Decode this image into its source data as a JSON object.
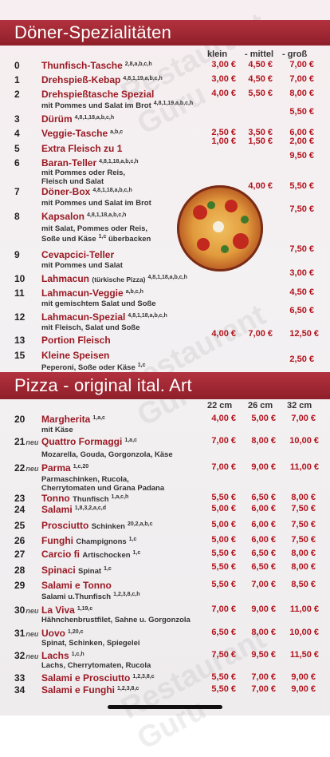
{
  "watermark": "Restaurant Guru",
  "sections": [
    {
      "id": "doener",
      "title": "Döner-Spezialitäten",
      "columns": [
        "klein",
        "- mittel",
        "- groß"
      ]
    },
    {
      "id": "pizza",
      "title": "Pizza - original ital. Art",
      "columns": [
        "22 cm",
        "26 cm",
        "32 cm"
      ]
    }
  ],
  "doener_items": [
    {
      "num": "0",
      "name": "Thunfisch-Tasche",
      "sup": "2,8,a,b,c,h",
      "p1": "3,00 €",
      "p2": "4,50 €",
      "p3": "7,00 €"
    },
    {
      "num": "1",
      "name": "Drehspieß-Kebap",
      "sup": "4,8,1,19,a,b,c,h",
      "p1": "3,00 €",
      "p2": "4,50 €",
      "p3": "7,00 €"
    },
    {
      "num": "2",
      "name": "Drehspießtasche Spezial",
      "sup": "",
      "p1": "4,00 €",
      "p2": "5,50 €",
      "p3": "8,00 €"
    },
    {
      "num": "3",
      "name": "Dürüm",
      "sup": "4,8,1,18,a,b,c,h",
      "p1": "",
      "p2": "",
      "p3": "5,50 €"
    },
    {
      "num": "4",
      "name": "Veggie-Tasche",
      "sup": "a,b,c",
      "p1": "2,50 €",
      "p2": "3,50 €",
      "p3": "6,00 €"
    },
    {
      "num": "5",
      "name": "Extra Fleisch zu 1",
      "sup": "",
      "p1": "1,00 €",
      "p2": "1,50 €",
      "p3": "2,00 €"
    },
    {
      "num": "6",
      "name": "Baran-Teller",
      "sup": "4,8,1,18,a,b,c,h",
      "p1": "",
      "p2": "",
      "p3": "9,50 €"
    },
    {
      "num": "7",
      "name": "Döner-Box",
      "sup": "4,8,1,18,a,b,c,h",
      "p1": "",
      "p2": "4,00 €",
      "p3": "5,50 €"
    },
    {
      "num": "8",
      "name": "Kapsalon",
      "sup": "4,8,1,18,a,b,c,h",
      "p1": "",
      "p2": "",
      "p3": "7,50 €"
    },
    {
      "num": "9",
      "name": "Cevapcici-Teller",
      "sup": "",
      "p1": "",
      "p2": "",
      "p3": "7,50 €"
    },
    {
      "num": "10",
      "name": "Lahmacun",
      "sup": "4,8,1,18,a,b,c,h",
      "p1": "",
      "p2": "",
      "p3": "3,00 €"
    },
    {
      "num": "11",
      "name": "Lahmacun-Veggie",
      "sup": "a,b,c,h",
      "p1": "",
      "p2": "",
      "p3": "4,50 €"
    },
    {
      "num": "12",
      "name": "Lahmacun-Spezial",
      "sup": "4,8,1,18,a,b,c,h",
      "p1": "",
      "p2": "",
      "p3": "6,50 €"
    },
    {
      "num": "13",
      "name": "Portion Fleisch",
      "sup": "",
      "p1": "4,00 €",
      "p2": "7,00 €",
      "p3": "12,50 €"
    },
    {
      "num": "15",
      "name": "Kleine Speisen",
      "sup": "",
      "p1": "",
      "p2": "",
      "p3": "2,50 €"
    }
  ],
  "doener_desc": {
    "d2": "mit Pommes und Salat im Brot",
    "d2sup": "4,8,1,19,a,b,c,h",
    "d6a": "mit Pommes oder Reis,",
    "d6b": "Fleisch und Salat",
    "d7": "mit Pommes und Salat im Brot",
    "d8a": "mit Salat, Pommes oder Reis,",
    "d8b": "Soße und Käse",
    "d8sup": "1,c",
    "d8c": "überbacken",
    "d9": "mit Pommes und Salat",
    "d10": "(türkische Pizza)",
    "d11": "mit gemischtem Salat und Soße",
    "d12": "mit Fleisch, Salat und Soße",
    "d15": "Peperoni, Soße oder Käse",
    "d15sup": "1,c"
  },
  "pizza_items": [
    {
      "num": "20",
      "neu": "",
      "name": "Margherita",
      "sup": "1,a,c",
      "p1": "4,00 €",
      "p2": "5,00 €",
      "p3": "7,00 €"
    },
    {
      "num": "21",
      "neu": "neu",
      "name": "Quattro Formaggi",
      "sup": "1,a,c",
      "p1": "7,00 €",
      "p2": "8,00 €",
      "p3": "10,00 €"
    },
    {
      "num": "22",
      "neu": "neu",
      "name": "Parma",
      "sup": "1,c,20",
      "p1": "7,00 €",
      "p2": "9,00 €",
      "p3": "11,00 €"
    },
    {
      "num": "23",
      "neu": "",
      "name": "Tonno",
      "sup": "",
      "p1": "5,50 €",
      "p2": "6,50 €",
      "p3": "8,00 €"
    },
    {
      "num": "24",
      "neu": "",
      "name": "Salami",
      "sup": "1,8,3,2,a,c,d",
      "p1": "5,00 €",
      "p2": "6,00 €",
      "p3": "7,50 €"
    },
    {
      "num": "25",
      "neu": "",
      "name": "Prosciutto",
      "sup": "",
      "p1": "5,00 €",
      "p2": "6,00 €",
      "p3": "7,50 €"
    },
    {
      "num": "26",
      "neu": "",
      "name": "Funghi",
      "sup": "",
      "p1": "5,00 €",
      "p2": "6,00 €",
      "p3": "7,50 €"
    },
    {
      "num": "27",
      "neu": "",
      "name": "Carcio fi",
      "sup": "",
      "p1": "5,50 €",
      "p2": "6,50 €",
      "p3": "8,00 €"
    },
    {
      "num": "28",
      "neu": "",
      "name": "Spinaci",
      "sup": "",
      "p1": "5,50 €",
      "p2": "6,50 €",
      "p3": "8,00 €"
    },
    {
      "num": "29",
      "neu": "",
      "name": "Salami e Tonno",
      "sup": "",
      "p1": "5,50 €",
      "p2": "7,00 €",
      "p3": "8,50 €"
    },
    {
      "num": "30",
      "neu": "neu",
      "name": "La Viva",
      "sup": "1,19,c",
      "p1": "7,00 €",
      "p2": "9,00 €",
      "p3": "11,00 €"
    },
    {
      "num": "31",
      "neu": "neu",
      "name": "Uovo",
      "sup": "1,20,c",
      "p1": "6,50 €",
      "p2": "8,00 €",
      "p3": "10,00 €"
    },
    {
      "num": "32",
      "neu": "neu",
      "name": "Lachs",
      "sup": "1,c,h",
      "p1": "7,50 €",
      "p2": "9,50 €",
      "p3": "11,50 €"
    },
    {
      "num": "33",
      "neu": "",
      "name": "Salami e Prosciutto",
      "sup": "1,2,3,8,c",
      "p1": "5,50 €",
      "p2": "7,00 €",
      "p3": "9,00 €"
    },
    {
      "num": "34",
      "neu": "",
      "name": "Salami e Funghi",
      "sup": "1,2,3,8,c",
      "p1": "5,50 €",
      "p2": "7,00 €",
      "p3": "9,00 €"
    }
  ],
  "pizza_desc": {
    "d20": "mit Käse",
    "d21": "Mozarella, Gouda, Gorgonzola, Käse",
    "d22a": "Parmaschinken, Rucola,",
    "d22b": "Cherrytomaten und Grana Padana",
    "d23": "Thunfisch",
    "d23sup": "1,a,c,h",
    "d25": "Schinken",
    "d25sup": "20,2,a,b,c",
    "d26": "Champignons",
    "d26sup": "1,c",
    "d27": "Artischocken",
    "d27sup": "1,c",
    "d28": "Spinat",
    "d28sup": "1,c",
    "d29": "Salami u.Thunfisch",
    "d29sup": "1,2,3,8,c,h",
    "d30": "Hähnchenbrustfilet, Sahne u. Gorgonzola",
    "d31": "Spinat, Schinken, Spiegelei",
    "d32": "Lachs, Cherrytomaten, Rucola"
  },
  "colors": {
    "header_bg": "#a12833",
    "item_name": "#9a1a24",
    "price": "#b2141e"
  }
}
